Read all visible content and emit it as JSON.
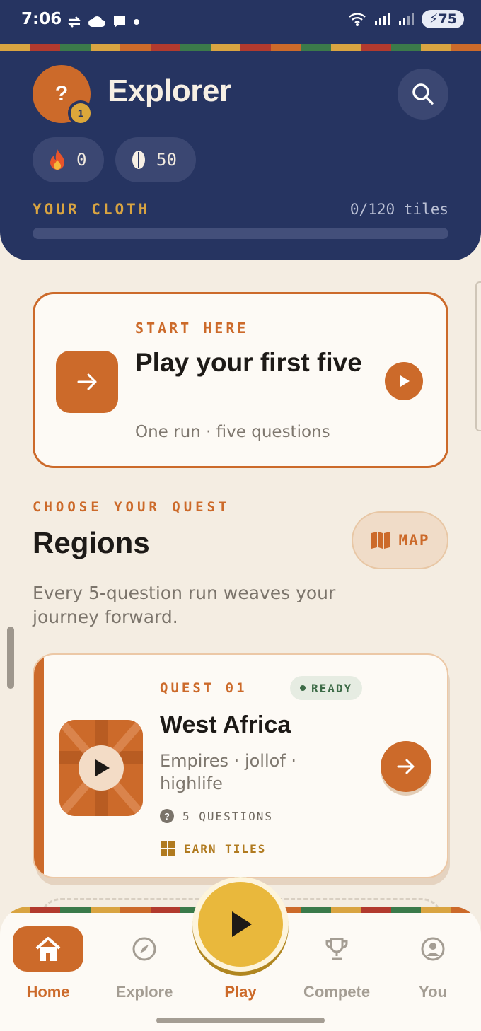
{
  "status_bar": {
    "time": "7:06",
    "battery": "75"
  },
  "colors": {
    "header_bg": "#263461",
    "accent": "#cc6a2a",
    "gold": "#d9a441",
    "page_bg": "#f4ede2",
    "ready_green": "#3d6b47",
    "kente": [
      "#d9a441",
      "#b23a2e",
      "#3b7a4a",
      "#d9a441",
      "#cc6a2a",
      "#b23a2e",
      "#3b7a4a",
      "#d9a441",
      "#b23a2e",
      "#cc6a2a",
      "#3b7a4a",
      "#d9a441",
      "#b23a2e",
      "#3b7a4a",
      "#d9a441",
      "#cc6a2a"
    ]
  },
  "profile": {
    "avatar_initial": "?",
    "level": "1",
    "name": "Explorer"
  },
  "stats": {
    "streak": "0",
    "coins": "50"
  },
  "cloth": {
    "label": "YOUR CLOTH",
    "count": "0/120 tiles",
    "progress": 0
  },
  "start_card": {
    "eyebrow": "START HERE",
    "title": "Play your first five",
    "subtitle": "One run · five questions"
  },
  "section": {
    "eyebrow": "CHOOSE YOUR QUEST",
    "title": "Regions",
    "map_label": "MAP",
    "description": "Every 5-question run weaves your journey forward."
  },
  "quest": {
    "eyebrow": "QUEST 01",
    "status": "READY",
    "title": "West Africa",
    "description": "Empires · jollof · highlife",
    "questions": "5 QUESTIONS",
    "reward": "EARN TILES"
  },
  "nav": {
    "home": "Home",
    "explore": "Explore",
    "play": "Play",
    "compete": "Compete",
    "you": "You"
  }
}
